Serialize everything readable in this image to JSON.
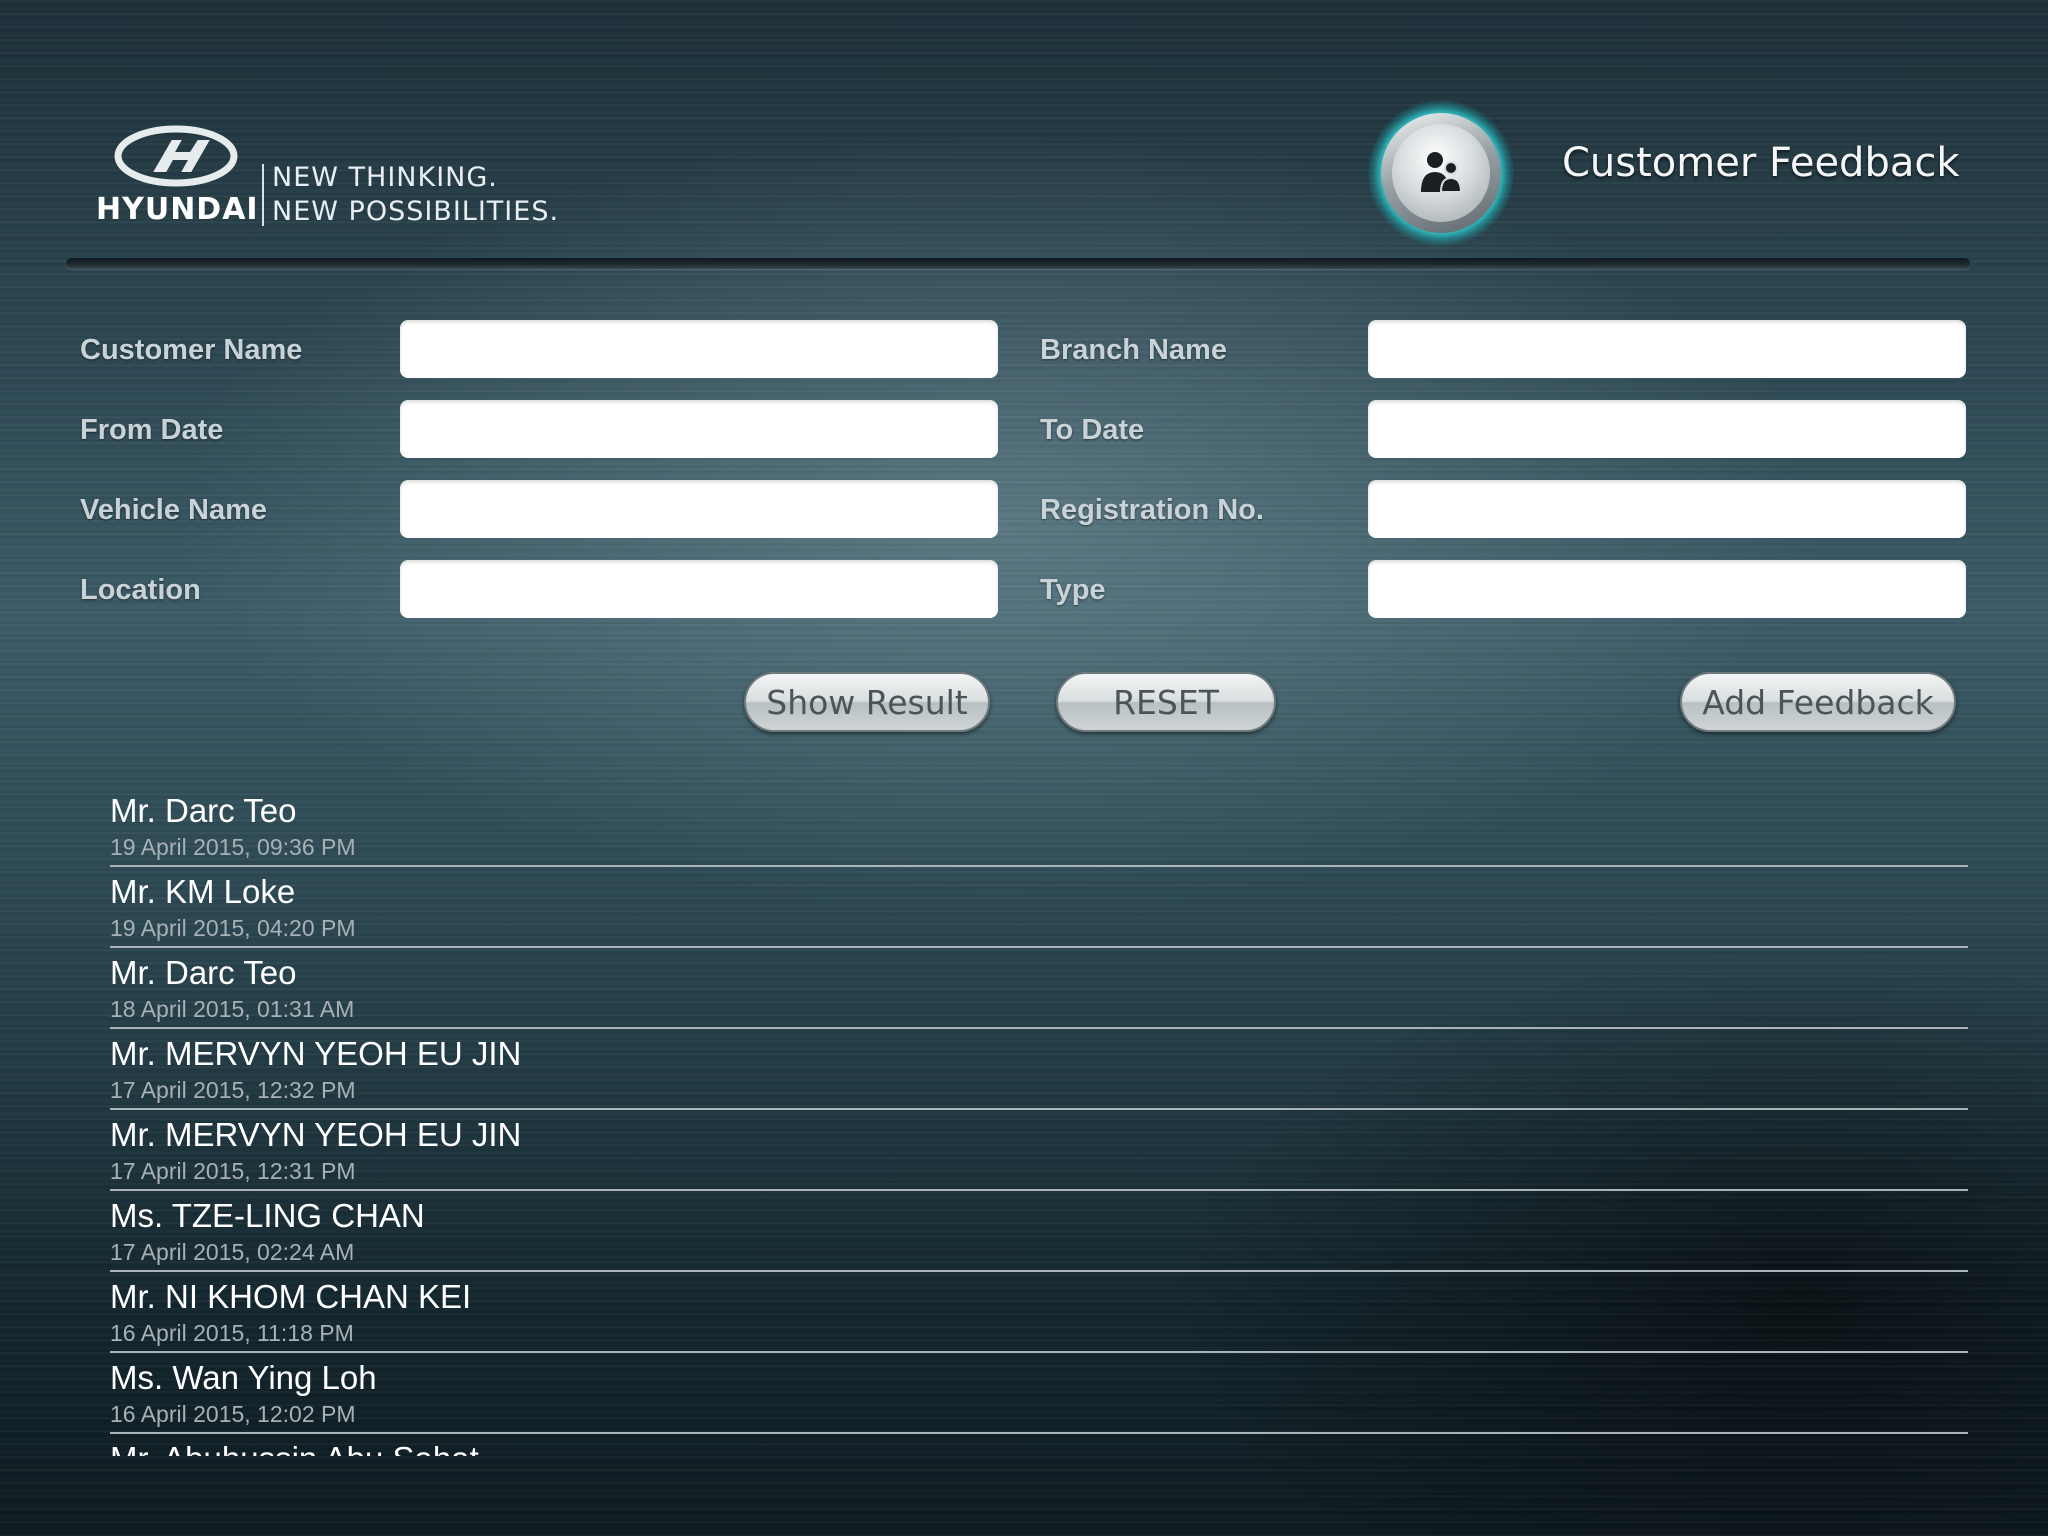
{
  "header": {
    "brand": "HYUNDAI",
    "tagline_line1": "NEW THINKING.",
    "tagline_line2": "NEW POSSIBILITIES.",
    "title": "Customer Feedback",
    "icon": "customer-group-icon"
  },
  "form": {
    "customer_name_label": "Customer Name",
    "customer_name_value": "",
    "branch_name_label": "Branch Name",
    "branch_name_value": "",
    "from_date_label": "From Date",
    "from_date_value": "",
    "to_date_label": "To Date",
    "to_date_value": "",
    "vehicle_name_label": "Vehicle Name",
    "vehicle_name_value": "",
    "registration_label": "Registration No.",
    "registration_value": "",
    "location_label": "Location",
    "location_value": "",
    "type_label": "Type",
    "type_value": ""
  },
  "buttons": {
    "show_result": "Show Result",
    "reset": "RESET",
    "add_feedback": "Add Feedback"
  },
  "feedback_list": [
    {
      "name": "Mr. Darc Teo",
      "date": "19 April 2015, 09:36 PM"
    },
    {
      "name": "Mr. KM Loke",
      "date": "19 April 2015, 04:20 PM"
    },
    {
      "name": "Mr. Darc Teo",
      "date": "18 April 2015, 01:31 AM"
    },
    {
      "name": "Mr. MERVYN YEOH EU JIN",
      "date": "17 April 2015, 12:32 PM"
    },
    {
      "name": "Mr. MERVYN YEOH EU JIN",
      "date": "17 April 2015, 12:31 PM"
    },
    {
      "name": "Ms. TZE-LING CHAN",
      "date": "17 April 2015, 02:24 AM"
    },
    {
      "name": "Mr. NI KHOM CHAN KEI",
      "date": "16 April 2015, 11:18 PM"
    },
    {
      "name": "Ms. Wan Ying Loh",
      "date": "16 April 2015, 12:02 PM"
    },
    {
      "name": "Mr. Abuhussin Abu Sahat",
      "date": ""
    }
  ],
  "colors": {
    "accent_glow": "#1aa5ad",
    "label_text": "#c9d3d7",
    "list_text": "#ffffff",
    "list_subtext": "#a7b1b5"
  }
}
